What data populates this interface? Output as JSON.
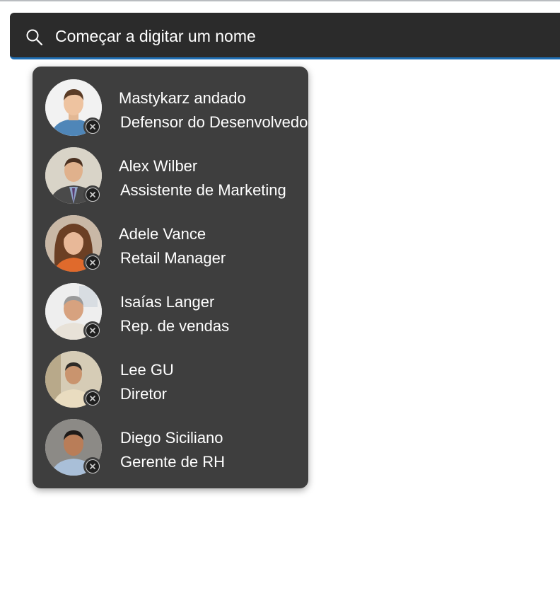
{
  "search": {
    "placeholder": "Começar a digitar um nome",
    "icon": "search-icon"
  },
  "colors": {
    "search_bg": "#2b2b2b",
    "accent": "#1f6fb5",
    "dropdown_bg": "#3e3e3e",
    "text": "#ffffff"
  },
  "people": [
    {
      "name": "Mastykarz andado",
      "title": "Defensor do Desenvolvedor"
    },
    {
      "name": "Alex Wilber",
      "title": "Assistente de Marketing"
    },
    {
      "name": "Adele Vance",
      "title": "Retail Manager"
    },
    {
      "name": "Isaías Langer",
      "title": "Rep. de vendas"
    },
    {
      "name": "Lee GU",
      "title": "Diretor"
    },
    {
      "name": "Diego Siciliano",
      "title": "Gerente de RH"
    }
  ]
}
